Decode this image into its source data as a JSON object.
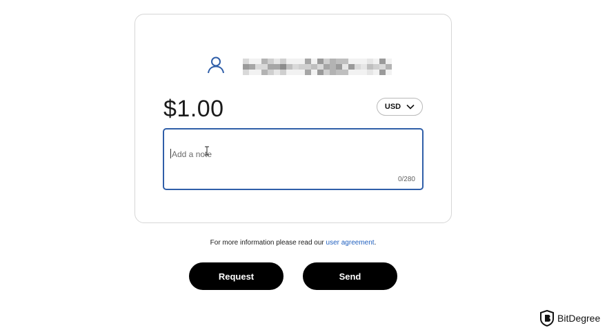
{
  "recipient": {
    "icon": "user-icon",
    "name_obscured": true
  },
  "payment": {
    "amount": "$1.00",
    "currency": "USD"
  },
  "note": {
    "placeholder": "Add a note",
    "counter": "0/280"
  },
  "info": {
    "text": "For more information please read our ",
    "link_text": "user agreement",
    "suffix": "."
  },
  "actions": {
    "request_label": "Request",
    "send_label": "Send"
  },
  "watermark": {
    "text": "BitDegree"
  },
  "colors": {
    "accent": "#2f5ea8",
    "link": "#1f5fbf",
    "button_bg": "#000000",
    "button_text": "#ffffff"
  }
}
